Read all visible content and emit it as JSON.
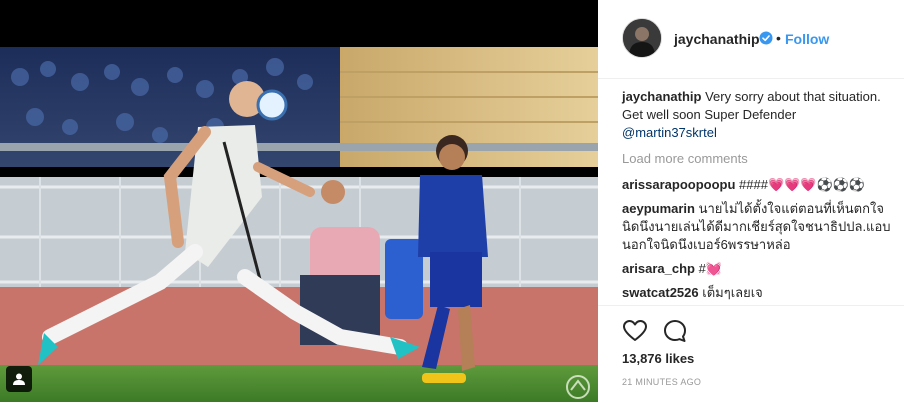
{
  "post": {
    "username": "jaychanathip",
    "follow_label": "Follow",
    "separator": "•",
    "caption_user": "jaychanathip",
    "caption_text": "Very sorry about that situation. Get well soon Super Defender",
    "caption_mention": "@martin37skrtel",
    "load_more_label": "Load more comments",
    "comments": [
      {
        "user": "arissarapoopoopu",
        "text": "####💗💗💗⚽⚽⚽"
      },
      {
        "user": "aeypumarin",
        "text": "นายไม่ได้ตั้งใจแต่ตอนที่เห็นตกใจนิดนึงนายเล่นได้ดีมากเชียร์สุดใจชนาธิปปล.แอบนอกใจนิดนึงเบอร์6พรรษาหล่อ"
      },
      {
        "user": "arisara_chp",
        "text": "#💓"
      },
      {
        "user": "swatcat2526",
        "text": "เต็มๆเลยเจ"
      }
    ],
    "likes_text": "13,876 likes",
    "timestamp": "21 MINUTES AGO"
  },
  "icons": {
    "like": "heart-icon",
    "comment": "comment-bubble-icon",
    "verified": "verified-badge-icon",
    "tag": "user-tag-icon"
  },
  "colors": {
    "link": "#3897f0",
    "text": "#262626",
    "muted": "#999999",
    "thai_jersey": "#1f3fa8",
    "opponent_kit": "#e9ece8"
  }
}
